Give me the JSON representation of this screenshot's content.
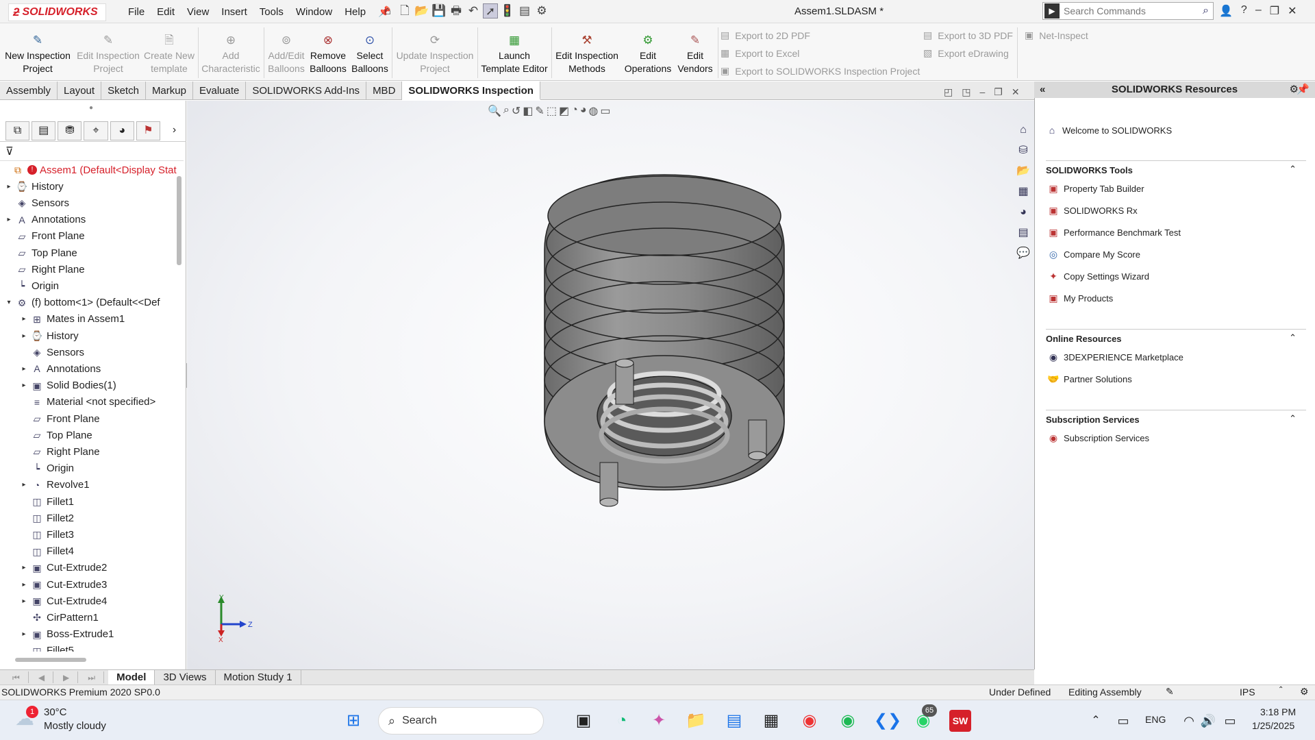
{
  "app": {
    "logo_text": "SOLIDWORKS",
    "menus": [
      "File",
      "Edit",
      "View",
      "Insert",
      "Tools",
      "Window",
      "Help"
    ],
    "document_title": "Assem1.SLDASM *",
    "search_placeholder": "Search Commands"
  },
  "ribbon": {
    "buttons": [
      {
        "line1": "New Inspection",
        "line2": "Project",
        "enabled": true,
        "icon": "new-inspection-icon"
      },
      {
        "line1": "Edit Inspection",
        "line2": "Project",
        "enabled": false,
        "icon": "edit-inspection-icon"
      },
      {
        "line1": "Create New",
        "line2": "template",
        "enabled": false,
        "icon": "template-icon"
      },
      {
        "line1": "Add",
        "line2": "Characteristic",
        "enabled": false,
        "icon": "characteristic-icon"
      },
      {
        "line1": "Add/Edit",
        "line2": "Balloons",
        "enabled": false,
        "icon": "balloon-icon"
      },
      {
        "line1": "Remove",
        "line2": "Balloons",
        "enabled": true,
        "icon": "remove-balloon-icon"
      },
      {
        "line1": "Select",
        "line2": "Balloons",
        "enabled": true,
        "icon": "select-balloon-icon"
      },
      {
        "line1": "Update Inspection",
        "line2": "Project",
        "enabled": false,
        "icon": "update-icon"
      },
      {
        "line1": "Launch",
        "line2": "Template Editor",
        "enabled": true,
        "icon": "launch-editor-icon"
      },
      {
        "line1": "Edit Inspection",
        "line2": "Methods",
        "enabled": true,
        "icon": "methods-icon"
      },
      {
        "line1": "Edit",
        "line2": "Operations",
        "enabled": true,
        "icon": "operations-icon"
      },
      {
        "line1": "Edit",
        "line2": "Vendors",
        "enabled": true,
        "icon": "vendors-icon"
      }
    ],
    "exports_left": [
      "Export to 2D PDF",
      "Export to Excel",
      "Export to SOLIDWORKS Inspection Project"
    ],
    "exports_right": [
      "Export to 3D PDF",
      "Export eDrawing"
    ],
    "net_inspect": "Net-Inspect"
  },
  "tabs": [
    "Assembly",
    "Layout",
    "Sketch",
    "Markup",
    "Evaluate",
    "SOLIDWORKS Add-Ins",
    "MBD",
    "SOLIDWORKS Inspection"
  ],
  "active_tab": "SOLIDWORKS Inspection",
  "tree": [
    {
      "label": "Assem1  (Default<Display Stat",
      "level": 0,
      "expand": "",
      "icon": "assembly-icon",
      "root": true
    },
    {
      "label": "History",
      "level": 1,
      "expand": "▸",
      "icon": "history-icon"
    },
    {
      "label": "Sensors",
      "level": 1,
      "expand": "",
      "icon": "sensor-icon"
    },
    {
      "label": "Annotations",
      "level": 1,
      "expand": "▸",
      "icon": "annotation-icon"
    },
    {
      "label": "Front Plane",
      "level": 1,
      "expand": "",
      "icon": "plane-icon"
    },
    {
      "label": "Top Plane",
      "level": 1,
      "expand": "",
      "icon": "plane-icon"
    },
    {
      "label": "Right Plane",
      "level": 1,
      "expand": "",
      "icon": "plane-icon"
    },
    {
      "label": "Origin",
      "level": 1,
      "expand": "",
      "icon": "origin-icon"
    },
    {
      "label": "(f) bottom<1> (Default<<Def",
      "level": 1,
      "expand": "▾",
      "icon": "part-icon"
    },
    {
      "label": "Mates in Assem1",
      "level": 2,
      "expand": "▸",
      "icon": "mates-icon"
    },
    {
      "label": "History",
      "level": 2,
      "expand": "▸",
      "icon": "history-icon"
    },
    {
      "label": "Sensors",
      "level": 2,
      "expand": "",
      "icon": "sensor-icon"
    },
    {
      "label": "Annotations",
      "level": 2,
      "expand": "▸",
      "icon": "annotation-icon"
    },
    {
      "label": "Solid Bodies(1)",
      "level": 2,
      "expand": "▸",
      "icon": "solid-bodies-icon"
    },
    {
      "label": "Material <not specified>",
      "level": 2,
      "expand": "",
      "icon": "material-icon"
    },
    {
      "label": "Front Plane",
      "level": 2,
      "expand": "",
      "icon": "plane-icon"
    },
    {
      "label": "Top Plane",
      "level": 2,
      "expand": "",
      "icon": "plane-icon"
    },
    {
      "label": "Right Plane",
      "level": 2,
      "expand": "",
      "icon": "plane-icon"
    },
    {
      "label": "Origin",
      "level": 2,
      "expand": "",
      "icon": "origin-icon"
    },
    {
      "label": "Revolve1",
      "level": 2,
      "expand": "▸",
      "icon": "revolve-icon"
    },
    {
      "label": "Fillet1",
      "level": 2,
      "expand": "",
      "icon": "fillet-icon"
    },
    {
      "label": "Fillet2",
      "level": 2,
      "expand": "",
      "icon": "fillet-icon"
    },
    {
      "label": "Fillet3",
      "level": 2,
      "expand": "",
      "icon": "fillet-icon"
    },
    {
      "label": "Fillet4",
      "level": 2,
      "expand": "",
      "icon": "fillet-icon"
    },
    {
      "label": "Cut-Extrude2",
      "level": 2,
      "expand": "▸",
      "icon": "cut-extrude-icon"
    },
    {
      "label": "Cut-Extrude3",
      "level": 2,
      "expand": "▸",
      "icon": "cut-extrude-icon"
    },
    {
      "label": "Cut-Extrude4",
      "level": 2,
      "expand": "▸",
      "icon": "cut-extrude-icon"
    },
    {
      "label": "CirPattern1",
      "level": 2,
      "expand": "",
      "icon": "pattern-icon"
    },
    {
      "label": "Boss-Extrude1",
      "level": 2,
      "expand": "▸",
      "icon": "boss-extrude-icon"
    },
    {
      "label": "Fillet5",
      "level": 2,
      "expand": "",
      "icon": "fillet-icon"
    }
  ],
  "resources": {
    "title": "SOLIDWORKS Resources",
    "welcome": "Welcome to SOLIDWORKS",
    "sections": [
      {
        "title": "SOLIDWORKS Tools",
        "items": [
          "Property Tab Builder",
          "SOLIDWORKS Rx",
          "Performance Benchmark Test",
          "Compare My Score",
          "Copy Settings Wizard",
          "My Products"
        ]
      },
      {
        "title": "Online Resources",
        "items": [
          "3DEXPERIENCE Marketplace",
          "Partner Solutions"
        ]
      },
      {
        "title": "Subscription Services",
        "items": [
          "Subscription Services"
        ]
      }
    ]
  },
  "bottom_tabs": [
    "Model",
    "3D Views",
    "Motion Study 1"
  ],
  "active_bottom_tab": "Model",
  "status": {
    "left": "SOLIDWORKS Premium 2020 SP0.0",
    "state": "Under Defined",
    "mode": "Editing Assembly",
    "units": "IPS"
  },
  "triad": {
    "y": "Y",
    "z": "Z",
    "x": "X"
  },
  "taskbar": {
    "weather_temp": "30°C",
    "weather_desc": "Mostly cloudy",
    "weather_badge": "1",
    "search": "Search",
    "whatsapp_badge": "65",
    "lang": "ENG",
    "time": "3:18 PM",
    "date": "1/25/2025"
  },
  "colors": {
    "accent": "#d6202a",
    "part": "#8a8a8a"
  }
}
